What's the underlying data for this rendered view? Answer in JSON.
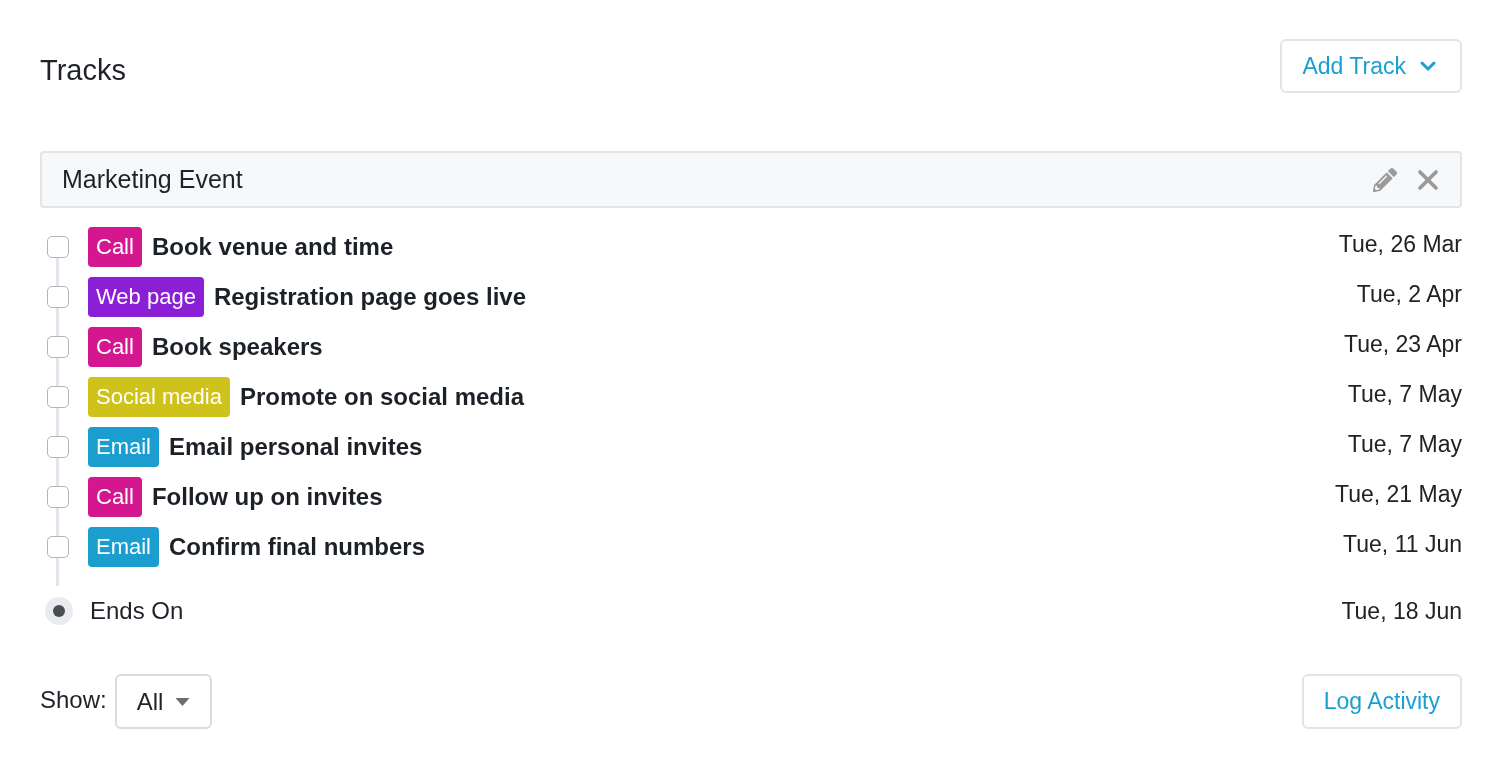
{
  "header": {
    "title": "Tracks",
    "add_button": {
      "label": "Add Track"
    }
  },
  "track": {
    "name": "Marketing Event",
    "items": [
      {
        "checked": false,
        "tag": {
          "label": "Call",
          "color": "#d4168f"
        },
        "title": "Book venue and time",
        "date": "Tue, 26 Mar"
      },
      {
        "checked": false,
        "tag": {
          "label": "Web page",
          "color": "#8a1fd6"
        },
        "title": "Registration page goes live",
        "date": "Tue, 2 Apr"
      },
      {
        "checked": false,
        "tag": {
          "label": "Call",
          "color": "#d4168f"
        },
        "title": "Book speakers",
        "date": "Tue, 23 Apr"
      },
      {
        "checked": false,
        "tag": {
          "label": "Social media",
          "color": "#cfc21a"
        },
        "title": "Promote on social media",
        "date": "Tue, 7 May"
      },
      {
        "checked": false,
        "tag": {
          "label": "Email",
          "color": "#1b9dd0"
        },
        "title": "Email personal invites",
        "date": "Tue, 7 May"
      },
      {
        "checked": false,
        "tag": {
          "label": "Call",
          "color": "#d4168f"
        },
        "title": "Follow up on invites",
        "date": "Tue, 21 May"
      },
      {
        "checked": false,
        "tag": {
          "label": "Email",
          "color": "#1b9dd0"
        },
        "title": "Confirm final numbers",
        "date": "Tue, 11 Jun"
      }
    ],
    "end": {
      "label": "Ends On",
      "date": "Tue, 18 Jun"
    }
  },
  "footer": {
    "show_label": "Show:",
    "filter": {
      "value": "All"
    },
    "log_button": {
      "label": "Log Activity"
    }
  }
}
